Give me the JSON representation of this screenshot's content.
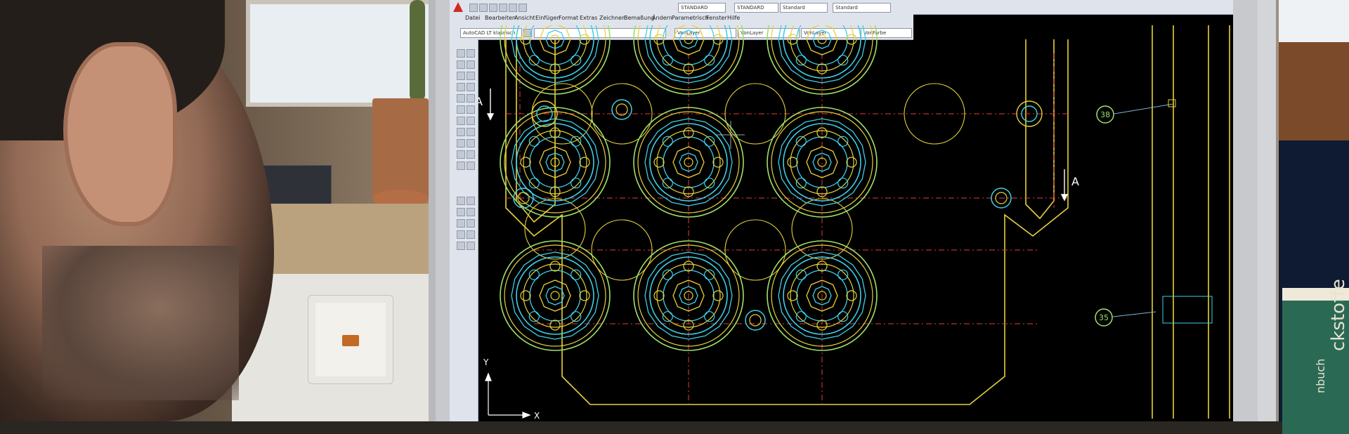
{
  "cad_app": {
    "menu": [
      "Datei",
      "Bearbeiten",
      "Ansicht",
      "Einfügen",
      "Format",
      "Extras",
      "Zeichnen",
      "Bemaßung",
      "Ändern",
      "Parametrisch",
      "Fenster",
      "Hilfe"
    ],
    "style_combos": [
      "STANDARD",
      "STANDARD",
      "Standard",
      "Standard"
    ],
    "layer_combos": [
      "VonLayer",
      "VonLayer",
      "VonLayer",
      "VonFarbe"
    ],
    "workspace": "AutoCAD LT klassisch"
  },
  "drawing": {
    "section_labels": [
      "A",
      "A"
    ],
    "balloons": [
      "38",
      "35"
    ],
    "axis_labels": {
      "y": "Y",
      "x": "X"
    },
    "colors": {
      "yellow": "#e6d23a",
      "cyan": "#3fd0e6",
      "green": "#9fe06a",
      "red": "#e23b3b"
    }
  },
  "book_spine": [
    "ckstoffe",
    "nbuch"
  ]
}
